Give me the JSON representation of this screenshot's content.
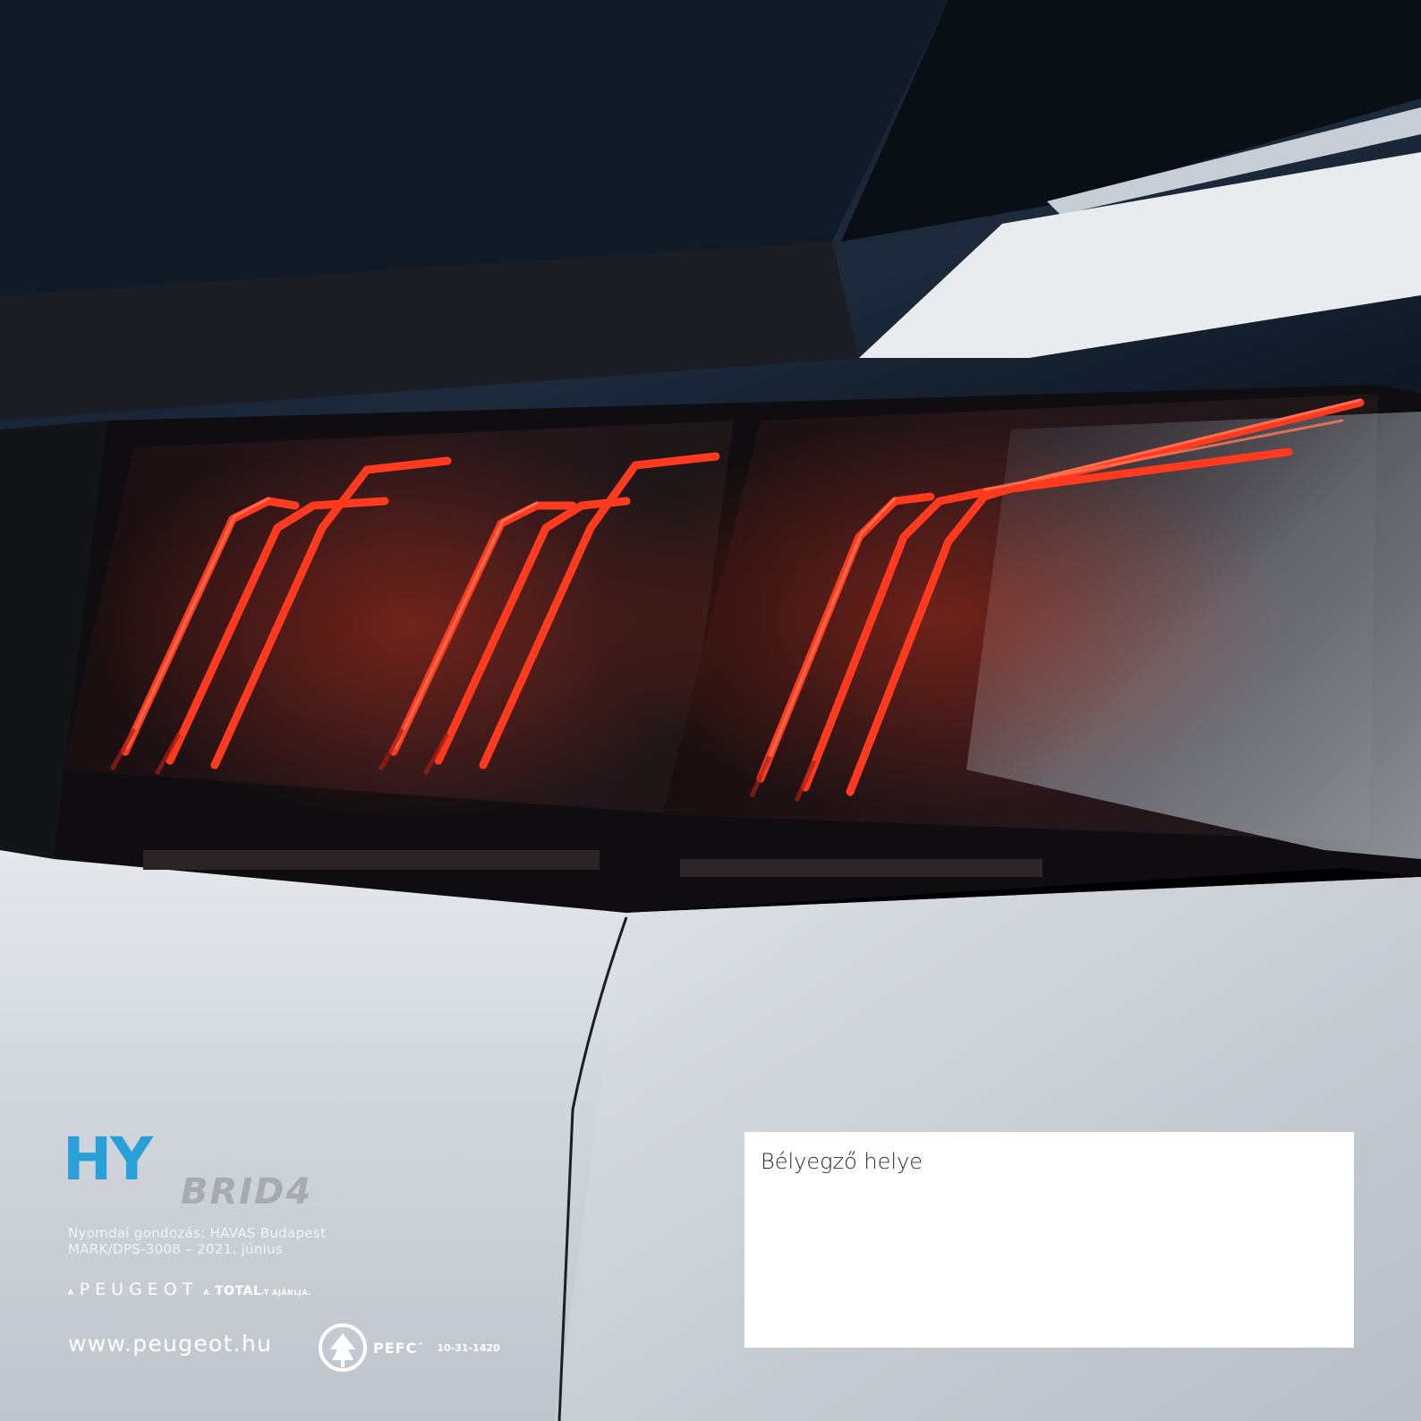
{
  "photo": {
    "subject": "white car rear with red LED tail lights"
  },
  "badge": {
    "text": "HYBRID4",
    "colors": {
      "hy": "#2aa0d8",
      "brid": "#a7abb0"
    }
  },
  "print_info": {
    "line1": "Nyomdai gondozás: HAVAS Budapest",
    "line2": "MARK/DPS-3008 – 2021. június"
  },
  "recommendation": {
    "prefix": "A",
    "brand": "PEUGEOT",
    "middle": "A",
    "partner": "TOTAL",
    "suffix": "-T AJÁNLJA."
  },
  "website": "www.peugeot.hu",
  "pefc": {
    "name": "PEFC",
    "tm": "™",
    "code": "10-31-1420"
  },
  "stamp": {
    "label": "Bélyegző helye"
  },
  "colors": {
    "text_on_photo": "#ffffff",
    "stamp_bg": "#ffffff",
    "tail_light": "#ff3a1e"
  }
}
